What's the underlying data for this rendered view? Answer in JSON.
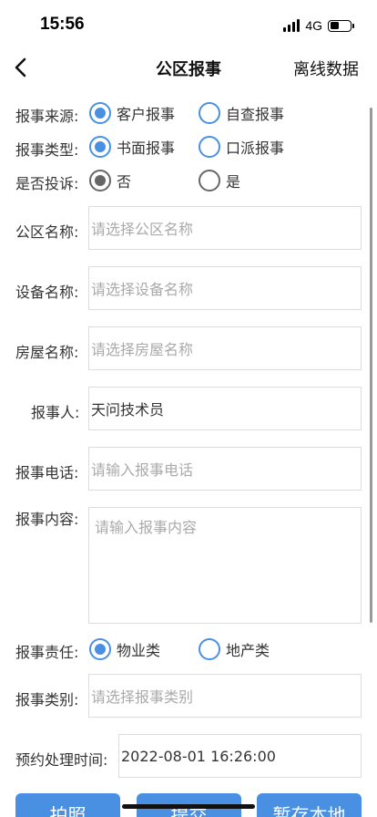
{
  "status_bar": {
    "time": "15:56",
    "network": "4G"
  },
  "nav": {
    "title": "公区报事",
    "right_action": "离线数据"
  },
  "source": {
    "label": "报事来源:",
    "options": [
      "客户报事",
      "自查报事"
    ],
    "selected": 0
  },
  "type": {
    "label": "报事类型:",
    "options": [
      "书面报事",
      "口派报事"
    ],
    "selected": 0
  },
  "complaint": {
    "label": "是否投诉:",
    "options": [
      "否",
      "是"
    ],
    "selected": 0
  },
  "area": {
    "label": "公区名称:",
    "placeholder": "请选择公区名称"
  },
  "device": {
    "label": "设备名称:",
    "placeholder": "请选择设备名称"
  },
  "house": {
    "label": "房屋名称:",
    "placeholder": "请选择房屋名称"
  },
  "reporter": {
    "label": "报事人:",
    "value": "天问技术员"
  },
  "phone": {
    "label": "报事电话:",
    "placeholder": "请输入报事电话"
  },
  "content": {
    "label": "报事内容:",
    "placeholder": "请输入报事内容"
  },
  "responsibility": {
    "label": "报事责任:",
    "options": [
      "物业类",
      "地产类"
    ],
    "selected": 0
  },
  "category": {
    "label": "报事类别:",
    "placeholder": "请选择报事类别"
  },
  "appointment": {
    "label": "预约处理时间:",
    "value": "2022-08-01 16:26:00"
  },
  "buttons": {
    "photo": "拍照",
    "submit": "提交",
    "save_local": "暂存本地"
  },
  "colors": {
    "accent": "#4a90e2",
    "border": "#dddddd",
    "placeholder": "#aaaaaa"
  }
}
